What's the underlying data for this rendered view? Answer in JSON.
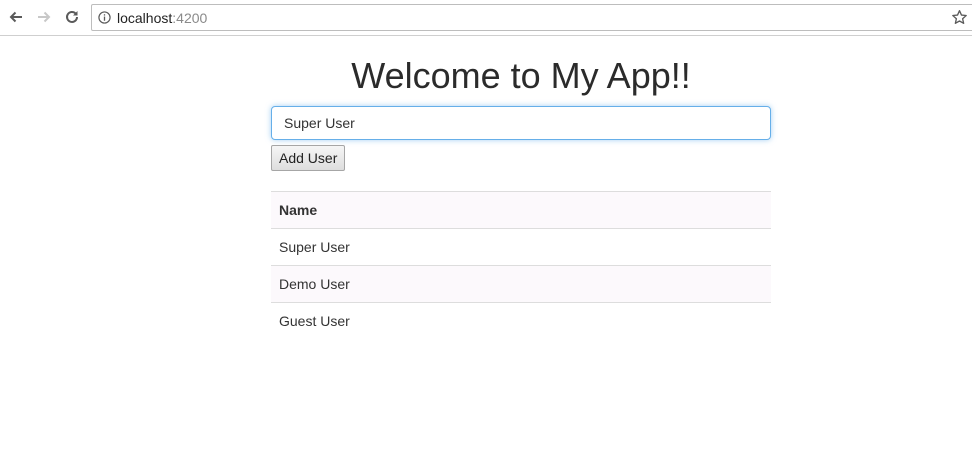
{
  "browser": {
    "url_host": "localhost",
    "url_port": ":4200",
    "back_icon": "back-arrow-icon",
    "forward_icon": "forward-arrow-icon",
    "reload_icon": "reload-icon",
    "info_icon": "info-icon",
    "bookmark_icon": "star-icon"
  },
  "page": {
    "title": "Welcome to My App!!",
    "input_value": "Super User",
    "add_button_label": "Add User",
    "table": {
      "header": "Name",
      "rows": [
        "Super User",
        "Demo User",
        "Guest User"
      ]
    }
  },
  "colors": {
    "input_focus_border": "#66afe9",
    "row_stripe": "#fcf9fc",
    "forward_disabled": "#c8c8c8"
  }
}
